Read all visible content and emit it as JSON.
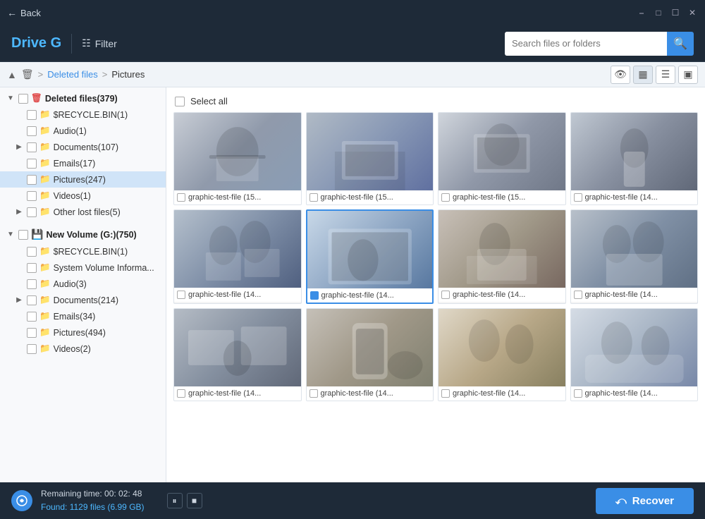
{
  "titlebar": {
    "back_label": "Back",
    "controls": [
      "minimize",
      "maximize",
      "restore",
      "close"
    ]
  },
  "header": {
    "drive_title": "Drive G",
    "filter_label": "Filter",
    "search_placeholder": "Search files or folders"
  },
  "breadcrumb": {
    "up_icon": "▲",
    "trash_icon": "🗑",
    "deleted_files": "Deleted files",
    "separator": ">",
    "current": "Pictures"
  },
  "view_controls": {
    "eye_icon": "👁",
    "grid_icon": "▦",
    "list_icon": "☰",
    "detail_icon": "⊡"
  },
  "sidebar": {
    "groups": [
      {
        "id": "deleted-files",
        "label": "Deleted files(379)",
        "icon": "trash",
        "expanded": true,
        "items": [
          {
            "label": "$RECYCLE.BIN(1)",
            "indent": 1
          },
          {
            "label": "Audio(1)",
            "indent": 1
          },
          {
            "label": "Documents(107)",
            "indent": 1,
            "expandable": true
          },
          {
            "label": "Emails(17)",
            "indent": 1
          },
          {
            "label": "Pictures(247)",
            "indent": 1,
            "selected": true
          },
          {
            "label": "Videos(1)",
            "indent": 1
          },
          {
            "label": "Other lost files(5)",
            "indent": 1,
            "expandable": true
          }
        ]
      },
      {
        "id": "new-volume",
        "label": "New Volume (G:)(750)",
        "icon": "drive",
        "expanded": true,
        "items": [
          {
            "label": "$RECYCLE.BIN(1)",
            "indent": 1
          },
          {
            "label": "System Volume Informa...",
            "indent": 1
          },
          {
            "label": "Audio(3)",
            "indent": 1
          },
          {
            "label": "Documents(214)",
            "indent": 1,
            "expandable": true
          },
          {
            "label": "Emails(34)",
            "indent": 1
          },
          {
            "label": "Pictures(494)",
            "indent": 1
          },
          {
            "label": "Videos(2)",
            "indent": 1
          }
        ]
      }
    ]
  },
  "select_all_label": "Select all",
  "images": [
    {
      "label": "graphic-test-file (15...",
      "photo_class": "photo-1",
      "selected": false
    },
    {
      "label": "graphic-test-file (15...",
      "photo_class": "photo-2",
      "selected": false
    },
    {
      "label": "graphic-test-file (15...",
      "photo_class": "photo-3",
      "selected": false
    },
    {
      "label": "graphic-test-file (14...",
      "photo_class": "photo-4",
      "selected": false
    },
    {
      "label": "graphic-test-file (14...",
      "photo_class": "photo-5",
      "selected": false
    },
    {
      "label": "graphic-test-file (14...",
      "photo_class": "photo-6",
      "selected": true
    },
    {
      "label": "graphic-test-file (14...",
      "photo_class": "photo-7",
      "selected": false
    },
    {
      "label": "graphic-test-file (14...",
      "photo_class": "photo-8",
      "selected": false
    },
    {
      "label": "graphic-test-file (14...",
      "photo_class": "photo-9",
      "selected": false
    },
    {
      "label": "graphic-test-file (14...",
      "photo_class": "photo-10",
      "selected": false
    },
    {
      "label": "graphic-test-file (14...",
      "photo_class": "photo-11",
      "selected": false
    },
    {
      "label": "graphic-test-file (14...",
      "photo_class": "photo-12",
      "selected": false
    }
  ],
  "statusbar": {
    "remaining_time_label": "Remaining time: 00: 02: 48",
    "found_label": "Found: 1129 files (6.99 GB)",
    "pause_icon": "⏸",
    "stop_icon": "■",
    "recover_label": "Recover",
    "recover_icon": "↩"
  }
}
